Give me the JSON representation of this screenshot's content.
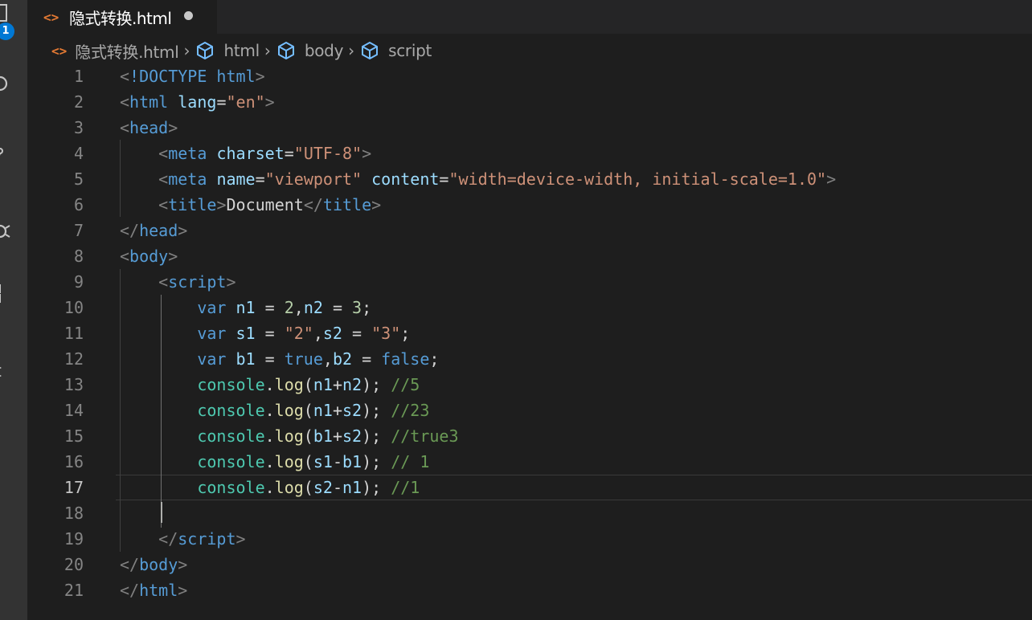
{
  "activity_bar": {
    "badge_count": "1",
    "icons": [
      "explorer-icon",
      "search-icon",
      "source-control-icon",
      "debug-icon",
      "extensions-icon",
      "remote-icon"
    ]
  },
  "tab": {
    "title": "隐式转换.html",
    "dirty": true,
    "icon": "html-file-icon"
  },
  "breadcrumb": {
    "items": [
      "隐式转换.html",
      "html",
      "body",
      "script"
    ]
  },
  "editor": {
    "active_line": 17,
    "lines": [
      [
        [
          "c-punct",
          "<"
        ],
        [
          "c-tag",
          "!DOCTYPE html"
        ],
        [
          "c-punct",
          ">"
        ]
      ],
      [
        [
          "c-punct",
          "<"
        ],
        [
          "c-tag",
          "html"
        ],
        [
          "c-text",
          " "
        ],
        [
          "c-attr",
          "lang"
        ],
        [
          "c-text",
          "="
        ],
        [
          "c-str",
          "\"en\""
        ],
        [
          "c-punct",
          ">"
        ]
      ],
      [
        [
          "c-punct",
          "<"
        ],
        [
          "c-tag",
          "head"
        ],
        [
          "c-punct",
          ">"
        ]
      ],
      [
        [
          "c-text",
          "    "
        ],
        [
          "c-punct",
          "<"
        ],
        [
          "c-tag",
          "meta"
        ],
        [
          "c-text",
          " "
        ],
        [
          "c-attr",
          "charset"
        ],
        [
          "c-text",
          "="
        ],
        [
          "c-str",
          "\"UTF-8\""
        ],
        [
          "c-punct",
          ">"
        ]
      ],
      [
        [
          "c-text",
          "    "
        ],
        [
          "c-punct",
          "<"
        ],
        [
          "c-tag",
          "meta"
        ],
        [
          "c-text",
          " "
        ],
        [
          "c-attr",
          "name"
        ],
        [
          "c-text",
          "="
        ],
        [
          "c-str",
          "\"viewport\""
        ],
        [
          "c-text",
          " "
        ],
        [
          "c-attr",
          "content"
        ],
        [
          "c-text",
          "="
        ],
        [
          "c-str",
          "\"width=device-width, initial-scale=1.0\""
        ],
        [
          "c-punct",
          ">"
        ]
      ],
      [
        [
          "c-text",
          "    "
        ],
        [
          "c-punct",
          "<"
        ],
        [
          "c-tag",
          "title"
        ],
        [
          "c-punct",
          ">"
        ],
        [
          "c-text",
          "Document"
        ],
        [
          "c-punct",
          "</"
        ],
        [
          "c-tag",
          "title"
        ],
        [
          "c-punct",
          ">"
        ]
      ],
      [
        [
          "c-punct",
          "</"
        ],
        [
          "c-tag",
          "head"
        ],
        [
          "c-punct",
          ">"
        ]
      ],
      [
        [
          "c-punct",
          "<"
        ],
        [
          "c-tag",
          "body"
        ],
        [
          "c-punct",
          ">"
        ]
      ],
      [
        [
          "c-text",
          "    "
        ],
        [
          "c-punct",
          "<"
        ],
        [
          "c-tag",
          "script"
        ],
        [
          "c-punct",
          ">"
        ]
      ],
      [
        [
          "c-text",
          "        "
        ],
        [
          "c-kw",
          "var"
        ],
        [
          "c-text",
          " "
        ],
        [
          "c-var",
          "n1"
        ],
        [
          "c-op",
          " = "
        ],
        [
          "c-num",
          "2"
        ],
        [
          "c-op",
          ","
        ],
        [
          "c-var",
          "n2"
        ],
        [
          "c-op",
          " = "
        ],
        [
          "c-num",
          "3"
        ],
        [
          "c-op",
          ";"
        ]
      ],
      [
        [
          "c-text",
          "        "
        ],
        [
          "c-kw",
          "var"
        ],
        [
          "c-text",
          " "
        ],
        [
          "c-var",
          "s1"
        ],
        [
          "c-op",
          " = "
        ],
        [
          "c-str",
          "\"2\""
        ],
        [
          "c-op",
          ","
        ],
        [
          "c-var",
          "s2"
        ],
        [
          "c-op",
          " = "
        ],
        [
          "c-str",
          "\"3\""
        ],
        [
          "c-op",
          ";"
        ]
      ],
      [
        [
          "c-text",
          "        "
        ],
        [
          "c-kw",
          "var"
        ],
        [
          "c-text",
          " "
        ],
        [
          "c-var",
          "b1"
        ],
        [
          "c-op",
          " = "
        ],
        [
          "c-kw",
          "true"
        ],
        [
          "c-op",
          ","
        ],
        [
          "c-var",
          "b2"
        ],
        [
          "c-op",
          " = "
        ],
        [
          "c-kw",
          "false"
        ],
        [
          "c-op",
          ";"
        ]
      ],
      [
        [
          "c-text",
          "        "
        ],
        [
          "c-cls",
          "console"
        ],
        [
          "c-op",
          "."
        ],
        [
          "c-fn",
          "log"
        ],
        [
          "c-op",
          "("
        ],
        [
          "c-var",
          "n1"
        ],
        [
          "c-op",
          "+"
        ],
        [
          "c-var",
          "n2"
        ],
        [
          "c-op",
          "); "
        ],
        [
          "c-cmt",
          "//5"
        ]
      ],
      [
        [
          "c-text",
          "        "
        ],
        [
          "c-cls",
          "console"
        ],
        [
          "c-op",
          "."
        ],
        [
          "c-fn",
          "log"
        ],
        [
          "c-op",
          "("
        ],
        [
          "c-var",
          "n1"
        ],
        [
          "c-op",
          "+"
        ],
        [
          "c-var",
          "s2"
        ],
        [
          "c-op",
          "); "
        ],
        [
          "c-cmt",
          "//23"
        ]
      ],
      [
        [
          "c-text",
          "        "
        ],
        [
          "c-cls",
          "console"
        ],
        [
          "c-op",
          "."
        ],
        [
          "c-fn",
          "log"
        ],
        [
          "c-op",
          "("
        ],
        [
          "c-var",
          "b1"
        ],
        [
          "c-op",
          "+"
        ],
        [
          "c-var",
          "s2"
        ],
        [
          "c-op",
          "); "
        ],
        [
          "c-cmt",
          "//true3"
        ]
      ],
      [
        [
          "c-text",
          "        "
        ],
        [
          "c-cls",
          "console"
        ],
        [
          "c-op",
          "."
        ],
        [
          "c-fn",
          "log"
        ],
        [
          "c-op",
          "("
        ],
        [
          "c-var",
          "s1"
        ],
        [
          "c-op",
          "-"
        ],
        [
          "c-var",
          "b1"
        ],
        [
          "c-op",
          "); "
        ],
        [
          "c-cmt",
          "// 1"
        ]
      ],
      [
        [
          "c-text",
          "        "
        ],
        [
          "c-cls",
          "console"
        ],
        [
          "c-op",
          "."
        ],
        [
          "c-fn",
          "log"
        ],
        [
          "c-op",
          "("
        ],
        [
          "c-var",
          "s2"
        ],
        [
          "c-op",
          "-"
        ],
        [
          "c-var",
          "n1"
        ],
        [
          "c-op",
          "); "
        ],
        [
          "c-cmt",
          "//1"
        ]
      ],
      [],
      [
        [
          "c-text",
          "    "
        ],
        [
          "c-punct",
          "</"
        ],
        [
          "c-tag",
          "script"
        ],
        [
          "c-punct",
          ">"
        ]
      ],
      [
        [
          "c-punct",
          "</"
        ],
        [
          "c-tag",
          "body"
        ],
        [
          "c-punct",
          ">"
        ]
      ],
      [
        [
          "c-punct",
          "</"
        ],
        [
          "c-tag",
          "html"
        ],
        [
          "c-punct",
          ">"
        ]
      ]
    ]
  }
}
